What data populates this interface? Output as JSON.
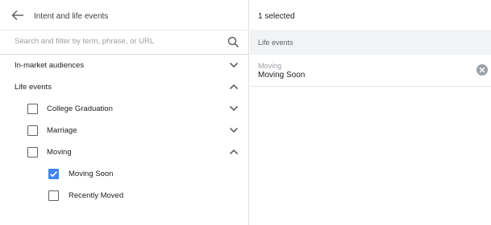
{
  "header": {
    "title": "Intent and life events",
    "back_icon": "arrow-left-icon"
  },
  "search": {
    "placeholder": "Search and filter by term, phrase, or URL",
    "value": "",
    "icon": "search-icon"
  },
  "categories": [
    {
      "label": "In-market audiences",
      "expanded": false
    },
    {
      "label": "Life events",
      "expanded": true
    }
  ],
  "life_events": [
    {
      "label": "College Graduation",
      "checked": false,
      "expanded": false
    },
    {
      "label": "Marriage",
      "checked": false,
      "expanded": false
    },
    {
      "label": "Moving",
      "checked": false,
      "expanded": true
    }
  ],
  "moving_children": [
    {
      "label": "Moving Soon",
      "checked": true
    },
    {
      "label": "Recently Moved",
      "checked": false
    }
  ],
  "selection": {
    "count_text": "1 selected",
    "group_label": "Life events",
    "items": [
      {
        "category": "Moving",
        "name": "Moving Soon",
        "remove_icon": "remove-circle-icon"
      }
    ]
  },
  "colors": {
    "accent": "#4285f4",
    "border": "#e0e0e0",
    "group_bg": "#f1f3f4"
  }
}
